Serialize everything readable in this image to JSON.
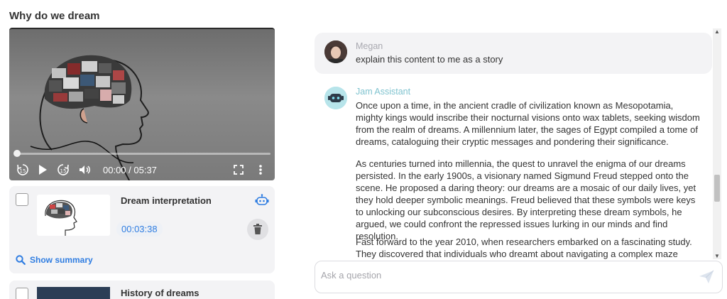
{
  "page": {
    "title": "Why do we dream"
  },
  "video": {
    "time": "00:00 / 05:37",
    "progress": 0.0
  },
  "cards": [
    {
      "title": "Dream interpretation",
      "duration": "00:03:38",
      "summary_label": "Show summary"
    },
    {
      "title": "History of dreams"
    }
  ],
  "chat": {
    "user": {
      "name": "Megan",
      "text": "explain this content to me as a story"
    },
    "assistant": {
      "name": "Jam Assistant",
      "paragraphs": [
        "Once upon a time, in the ancient cradle of civilization known as Mesopotamia, mighty kings would inscribe their nocturnal visions onto wax tablets, seeking wisdom from the realm of dreams. A millennium later, the sages of Egypt compiled a tome of dreams, cataloguing their cryptic messages and pondering their significance.",
        "As centuries turned into millennia, the quest to unravel the enigma of our dreams persisted. In the early 1900s, a visionary named Sigmund Freud stepped onto the scene. He proposed a daring theory: our dreams are a mosaic of our daily lives, yet they hold deeper symbolic meanings. Freud believed that these symbols were keys to unlocking our subconscious desires. By interpreting these dream symbols, he argued, we could confront the repressed issues lurking in our minds and find resolution.",
        "Fast forward to the year 2010, when researchers embarked on a fascinating study. They discovered that individuals who dreamt about navigating a complex maze"
      ]
    }
  },
  "ask": {
    "placeholder": "Ask a question"
  },
  "icons": {
    "rewind": "rewind-15-icon",
    "play": "play-icon",
    "forward": "forward-15-icon",
    "volume": "volume-icon",
    "fullscreen": "fullscreen-icon",
    "more": "more-vertical-icon",
    "bot": "robot-icon",
    "trash": "trash-icon",
    "search": "search-icon",
    "send": "send-icon"
  },
  "colors": {
    "accent": "#2f7de1",
    "assistant_name": "#7fc3cf",
    "user_name": "#a9a9b0"
  }
}
